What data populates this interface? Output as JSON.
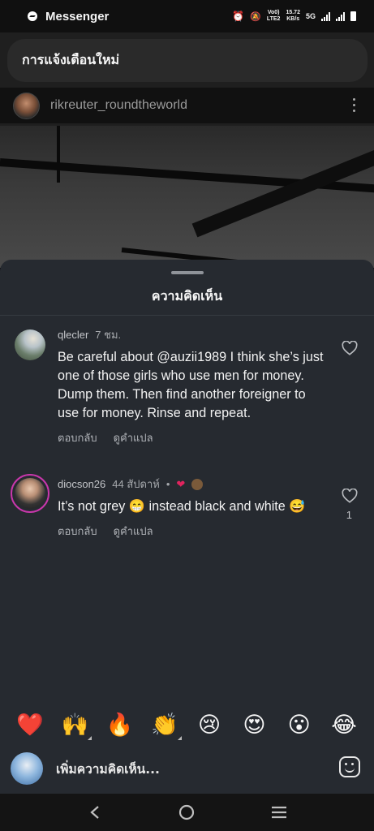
{
  "status_bar": {
    "app_name": "Messenger",
    "network_top": "Vo0)",
    "network_bottom": "LTE2",
    "speed_top": "15.72",
    "speed_bottom": "KB/s",
    "network_type": "5G"
  },
  "notification": {
    "text": "การแจ้งเตือนใหม่"
  },
  "post": {
    "username": "rikreuter_roundtheworld"
  },
  "comments_sheet": {
    "title": "ความคิดเห็น",
    "comments": [
      {
        "username": "qlecler",
        "time": "7 ชม.",
        "text": "Be careful about @auzii1989 I think she’s just one of those girls who use men for money. Dump them. Then find another foreigner to use for money. Rinse and repeat.",
        "reply_label": "ตอบกลับ",
        "translate_label": "ดูคำแปล",
        "likes": ""
      },
      {
        "username": "diocson26",
        "time": "44 สัปดาห์",
        "separator": "•",
        "text": "It’s not grey 😁 instead black and white 😅",
        "reply_label": "ตอบกลับ",
        "translate_label": "ดูคำแปล",
        "likes": "1"
      }
    ]
  },
  "reactions": [
    "❤️",
    "🙌",
    "🔥",
    "👏",
    "😢",
    "😍",
    "😮",
    "😂"
  ],
  "input": {
    "placeholder": "เพิ่มความคิดเห็น..."
  },
  "colors": {
    "sheet_bg": "#262a30",
    "like_red": "#e0245e",
    "story_ring": "#c837ab"
  }
}
